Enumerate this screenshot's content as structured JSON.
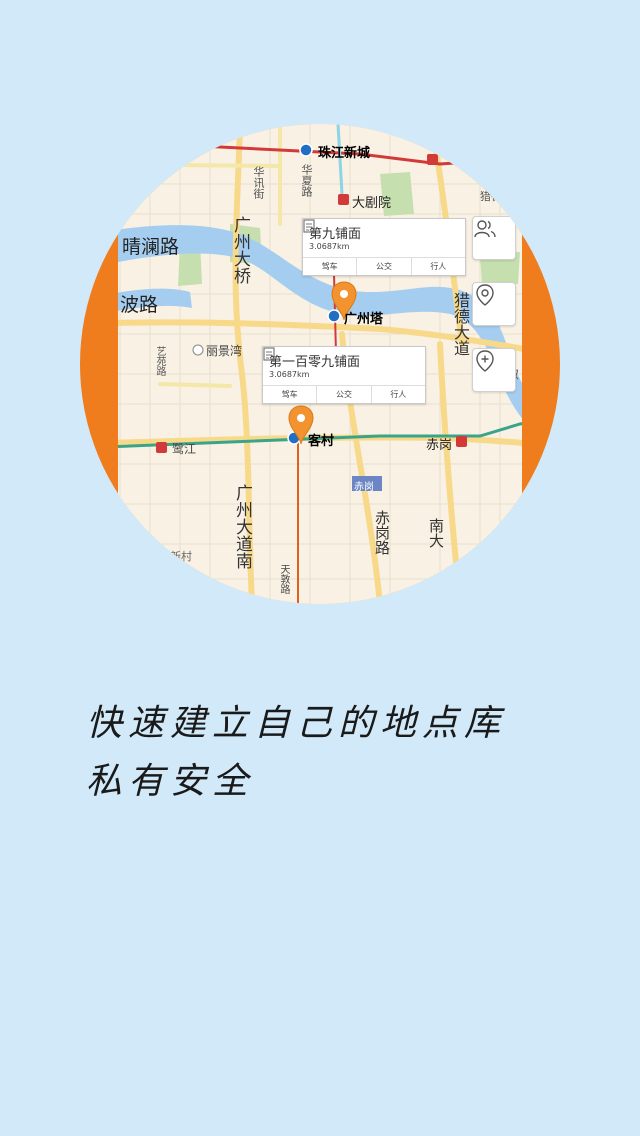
{
  "tagline": {
    "line1": "快速建立自己的地点库",
    "line2": "私有安全"
  },
  "map": {
    "labels": {
      "zhujiang_xincheng": "珠江新城",
      "qinglan_road": "晴澜路",
      "bo_road": "波路",
      "daju_yuan": "大剧院",
      "guangzhou_tower": "广州塔",
      "guangzhou_bridge": "广州大桥",
      "lijing_wan": "丽景湾",
      "kecun": "客村",
      "chigang": "赤岗",
      "chigang_badge": "赤岗",
      "chigang_road": "赤岗路",
      "guangzhou_dadao_nan": "广州大道南",
      "liede_dadao": "猎德大道",
      "xingcheng_south": "新城",
      "lujiang": "鹭江",
      "huaxun_street": "华讯街",
      "huajiu_road": "华夏路",
      "yaoji": "艺苑",
      "yiyuan_road": "艺苑路",
      "liede": "猎德",
      "partial_left_bottom": "新村",
      "partial_tianyuan": "天敦路",
      "bottom_right": "南大",
      "shuang": "双"
    },
    "card1": {
      "title": "第九铺面",
      "distance": "3.0687km",
      "btn_drive": "驾车",
      "btn_transit": "公交",
      "btn_walk": "行人"
    },
    "card2": {
      "title": "第一百零九铺面",
      "distance": "3.0687km",
      "btn_drive": "驾车",
      "btn_transit": "公交",
      "btn_walk": "行人"
    },
    "controls": {
      "friends_icon": "people-icon",
      "locate_icon": "location-pin-icon",
      "add_pin_icon": "add-location-icon"
    }
  },
  "colors": {
    "background": "#d1e9f8",
    "accent": "#ef7d1e",
    "river": "#a5cdf0",
    "park": "#c6dfae",
    "road": "#f8d98a",
    "metro_red": "#d23a3a",
    "metro_green": "#3aa48a"
  }
}
